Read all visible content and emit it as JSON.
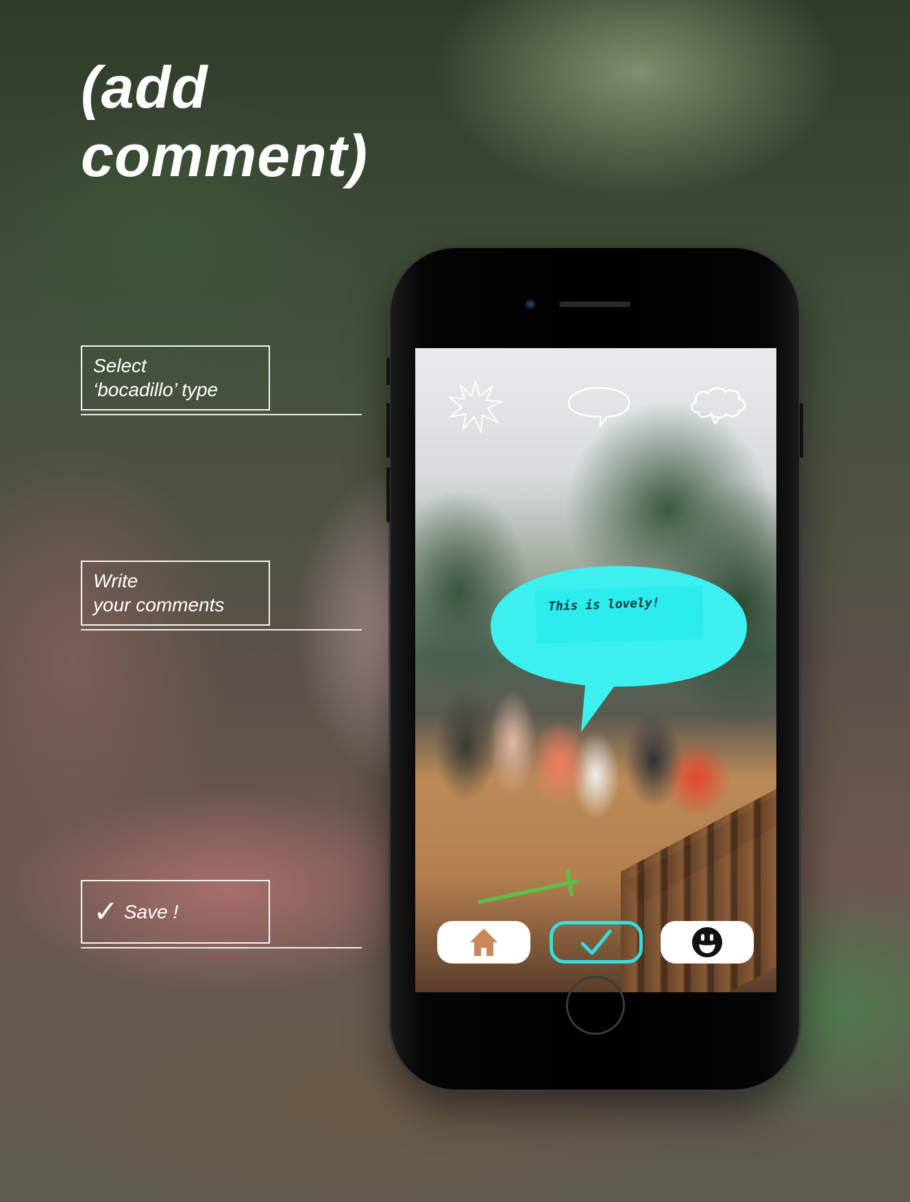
{
  "heading": {
    "line1": "(add",
    "line2": "comment)"
  },
  "steps": [
    {
      "line1": "Select",
      "line2": "‘bocadillo’ type"
    },
    {
      "line1": "Write",
      "line2": "your comments"
    },
    {
      "check": "✓",
      "label": "Save !"
    }
  ],
  "app": {
    "bubble_types": [
      "burst-bubble-icon",
      "speech-bubble-icon",
      "thought-bubble-icon"
    ],
    "comment_text": "This is lovely!",
    "accent_color": "#31dfe3",
    "bubble_color": "#3cf0f0",
    "nav": [
      {
        "name": "home-icon"
      },
      {
        "name": "check-icon",
        "selected": true
      },
      {
        "name": "smiley-icon"
      }
    ]
  }
}
